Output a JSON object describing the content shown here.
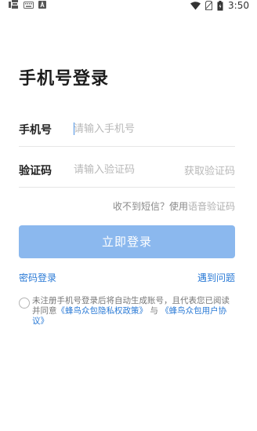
{
  "status_bar": {
    "time": "3:50",
    "left_icons": [
      "app-notification-icon",
      "keyboard-icon",
      "a-icon"
    ],
    "right_icons": [
      "wifi-icon",
      "no-sim-icon",
      "battery-icon"
    ]
  },
  "page": {
    "title": "手机号登录"
  },
  "form": {
    "phone_label": "手机号",
    "phone_placeholder": "请输入手机号",
    "code_label": "验证码",
    "code_placeholder": "请输入验证码",
    "get_code": "获取验证码",
    "voice_hint_prefix": "收不到短信？使用",
    "voice_hint_link": "语音验证码",
    "login_button": "立即登录"
  },
  "links": {
    "password_login": "密码登录",
    "problem": "遇到问题"
  },
  "agreement": {
    "text_prefix": "未注册手机号登录后将自动生成账号，且代表您已阅读并同意",
    "privacy_policy": "《蜂鸟众包隐私权政策》",
    "connector": "与",
    "user_agreement": "《蜂鸟众包用户协议》"
  },
  "colors": {
    "accent": "#2a7ad6",
    "button_disabled": "#8bb8ee",
    "placeholder": "#b8b8b8",
    "divider": "#e6e6e6"
  }
}
